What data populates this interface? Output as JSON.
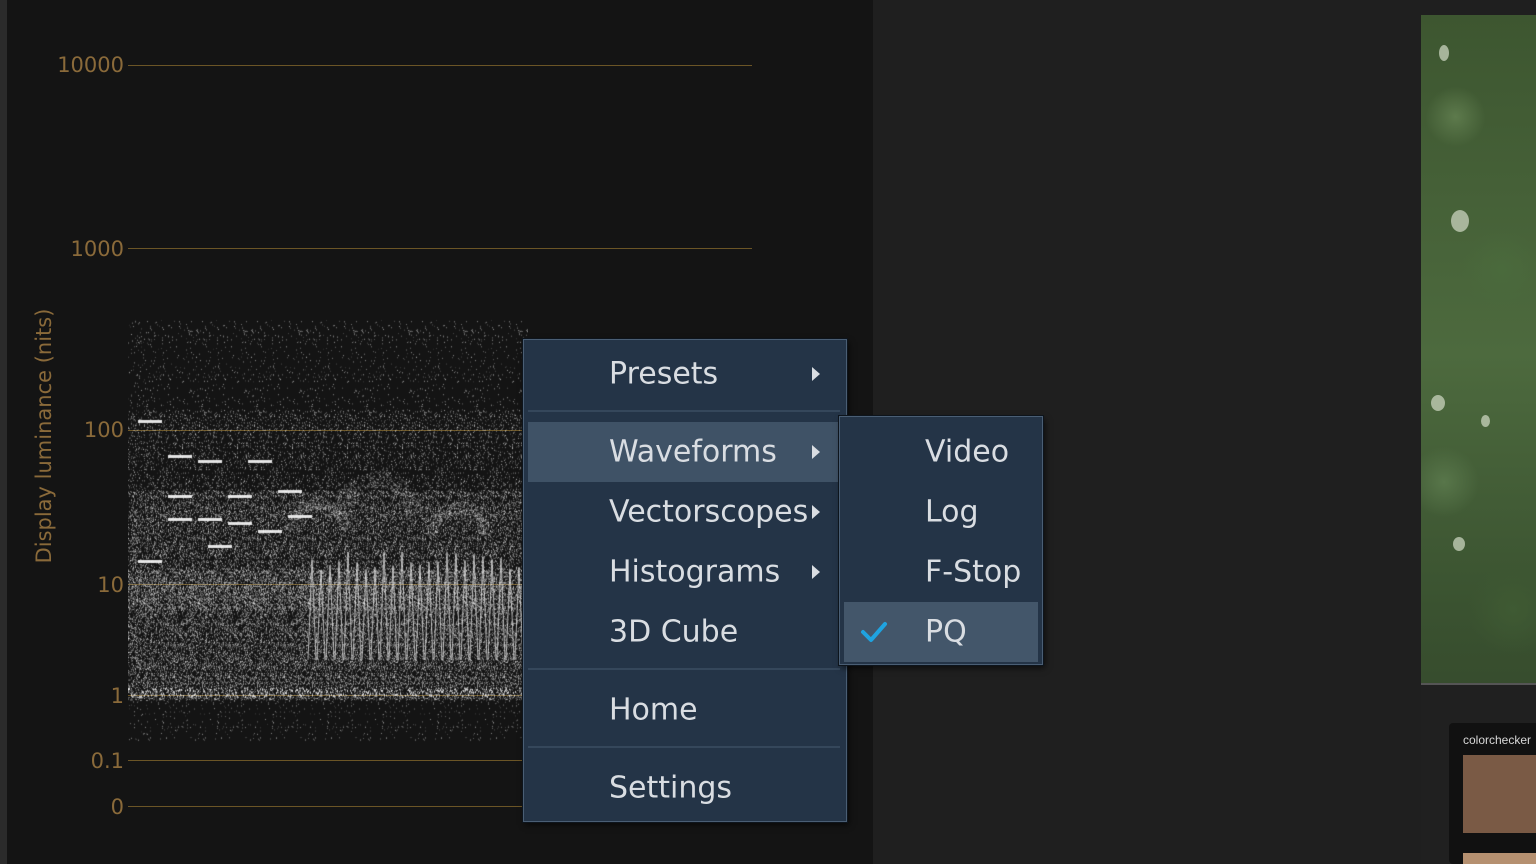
{
  "scope": {
    "axis_title": "Display luminance (nits)",
    "ticks": [
      "10000",
      "1000",
      "100",
      "10",
      "1",
      "0.1",
      "0"
    ]
  },
  "context_menu": {
    "items": [
      {
        "label": "Presets",
        "submenu": true
      },
      {
        "label": "Waveforms",
        "submenu": true,
        "highlighted": true
      },
      {
        "label": "Vectorscopes",
        "submenu": true
      },
      {
        "label": "Histograms",
        "submenu": true
      },
      {
        "label": "3D Cube",
        "submenu": false
      },
      {
        "label": "Home",
        "submenu": false
      },
      {
        "label": "Settings",
        "submenu": false
      }
    ]
  },
  "waveforms_submenu": {
    "items": [
      {
        "label": "Video",
        "checked": false
      },
      {
        "label": "Log",
        "checked": false
      },
      {
        "label": "F-Stop",
        "checked": false
      },
      {
        "label": "PQ",
        "checked": true
      }
    ]
  },
  "viewer": {
    "colorchecker_label": "colorchecker"
  },
  "colors": {
    "scale_accent": "#8a6a3a",
    "menu_bg": "#243447",
    "menu_highlight": "#3f5266",
    "check_accent": "#1fa3e0"
  }
}
